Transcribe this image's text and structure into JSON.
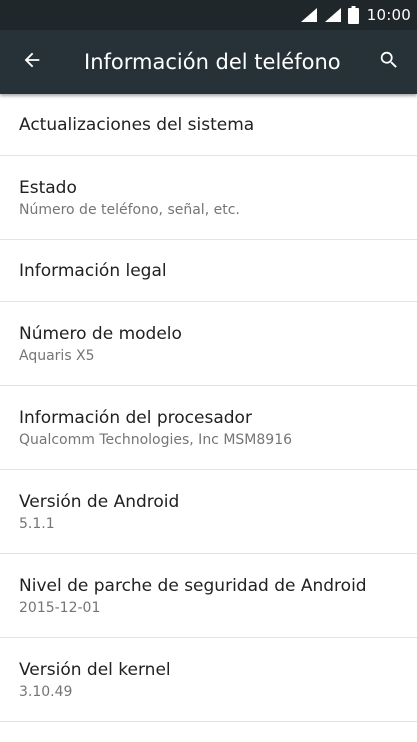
{
  "status_bar": {
    "time": "10:00",
    "icons": [
      "wifi-icon",
      "signal-icon",
      "battery-icon"
    ]
  },
  "app_bar": {
    "title": "Información del teléfono",
    "back_icon": "arrow-back-icon",
    "search_icon": "search-icon"
  },
  "colors": {
    "status_bar": "#1f272b",
    "app_bar": "#263238",
    "title_text": "#212121",
    "summary_text": "#757575"
  },
  "items": [
    {
      "title": "Actualizaciones del sistema",
      "summary": ""
    },
    {
      "title": "Estado",
      "summary": "Número de teléfono, señal, etc."
    },
    {
      "title": "Información legal",
      "summary": ""
    },
    {
      "title": "Número de modelo",
      "summary": "Aquaris X5"
    },
    {
      "title": "Información del procesador",
      "summary": "Qualcomm Technologies, Inc MSM8916"
    },
    {
      "title": "Versión de Android",
      "summary": "5.1.1"
    },
    {
      "title": "Nivel de parche de seguridad de Android",
      "summary": "2015-12-01"
    },
    {
      "title": "Versión del kernel",
      "summary": "3.10.49"
    }
  ]
}
